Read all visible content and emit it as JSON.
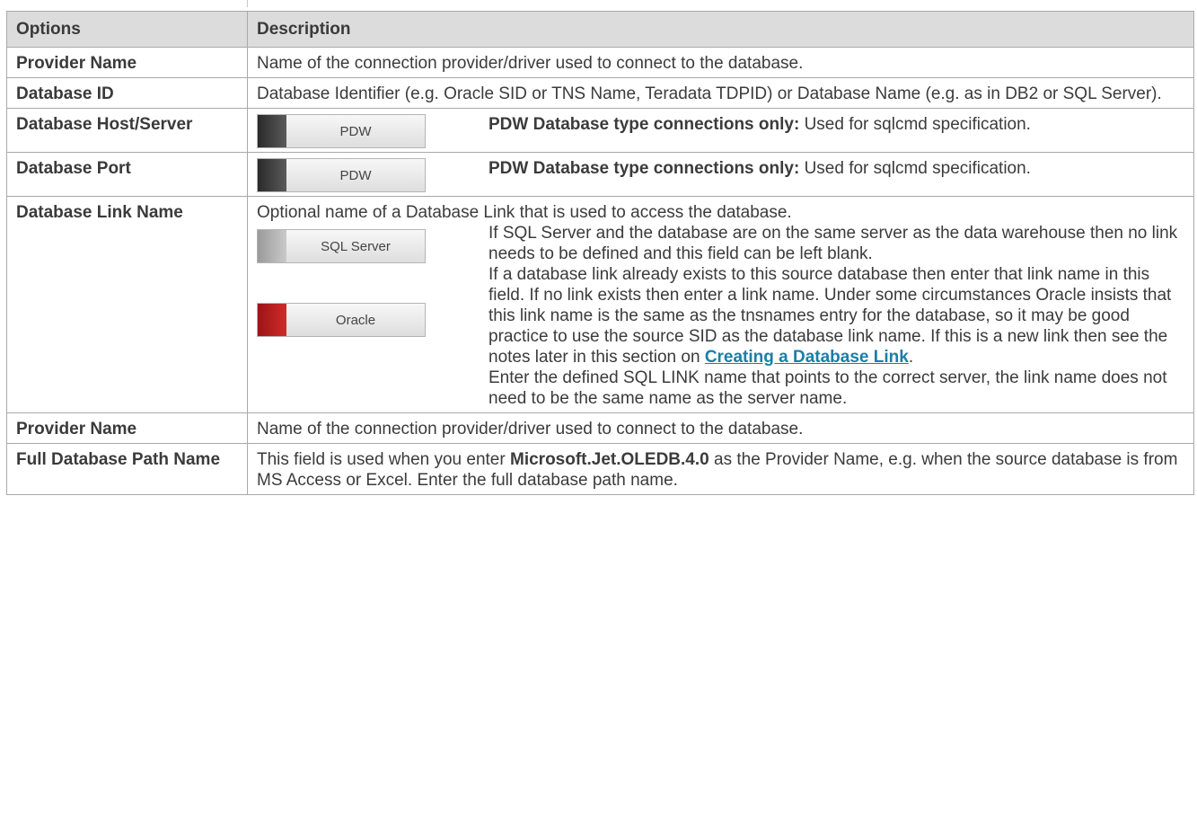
{
  "header": {
    "options": "Options",
    "description": "Description"
  },
  "rows": {
    "provider": {
      "option": "Provider Name",
      "desc": "Name of the connection provider/driver used to connect to the database."
    },
    "dbid": {
      "option": "Database ID",
      "desc": "Database Identifier (e.g. Oracle SID or TNS Name, Teradata TDPID) or Database Name (e.g. as in DB2 or SQL Server)."
    },
    "host": {
      "option": "Database Host/Server",
      "badge": "PDW",
      "lead": "PDW Database type connections only:",
      "text": " Used for sqlcmd specification."
    },
    "port": {
      "option": "Database Port",
      "badge": "PDW",
      "lead": "PDW Database type connections only:",
      "text": " Used for sqlcmd specification."
    },
    "link": {
      "option": "Database Link Name",
      "intro": "Optional name of a Database Link that is used to access the database.",
      "badge_sql": "SQL Server",
      "badge_oracle": "Oracle",
      "p1": "If SQL Server and the database are on the same server as the data warehouse then no link needs to be defined and this field can be left blank.",
      "p2": "If a database link already exists to this source database then enter that link name in this field. If no link exists then enter a link name. Under some circumstances Oracle insists that this link name is the same as the tnsnames entry for the database, so it may be good practice to use the source SID as the database link name. If this is a new link then see the notes later in this section on ",
      "p2_link": "Creating a Database Link",
      "p2_end": ".",
      "p3": "Enter the defined SQL LINK name that points to the correct server, the link name does not need to be the same name as the server name."
    },
    "provider2": {
      "option": "Provider Name",
      "desc": "Name of the connection provider/driver used to connect to the database."
    },
    "fullpath": {
      "option": "Full Database Path Name",
      "pre": "This field is used when you enter ",
      "bold": "Microsoft.Jet.OLEDB.4.0",
      "post": " as the Provider Name, e.g. when the source database is from MS Access or Excel. Enter the full database path name."
    }
  },
  "colors": {
    "header_bg": "#dcdcdc",
    "link": "#1a7fa6",
    "pdw": "#3a3a3a",
    "sql_server": "#b0b0b0",
    "oracle": "#c41e1e"
  }
}
